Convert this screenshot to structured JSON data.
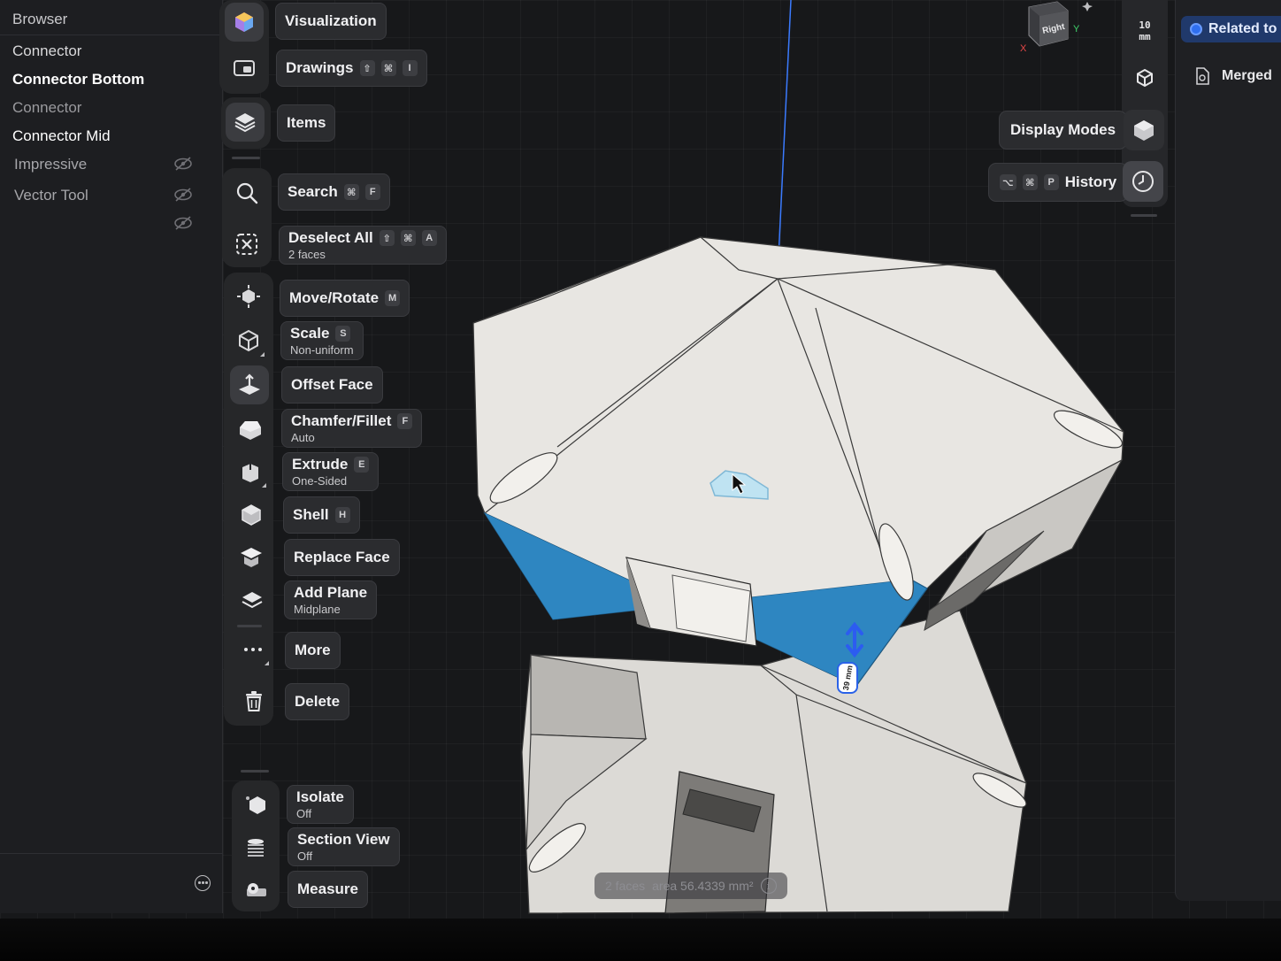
{
  "browser": {
    "title": "Browser",
    "items": [
      {
        "label": "Connector",
        "color": "#d8d8da"
      },
      {
        "label": "Connector Bottom",
        "color": "#ffffff",
        "weight": "bold"
      },
      {
        "label": "Connector",
        "color": "#9a9a9e"
      },
      {
        "label": "Connector Mid",
        "color": "#ffffff"
      },
      {
        "label": "Impressive",
        "color": "#a6a6aa",
        "hidden": true
      },
      {
        "label": "Vector Tool",
        "color": "#a6a6aa",
        "hidden": true
      },
      {
        "label": "",
        "hidden": true
      }
    ]
  },
  "toolbar": {
    "visualization": {
      "label": "Visualization",
      "icon": "cube-gradient-icon"
    },
    "drawings": {
      "label": "Drawings",
      "keys": [
        "⇧",
        "⌘",
        "I"
      ],
      "icon": "drawings-icon"
    },
    "items": {
      "label": "Items",
      "icon": "layers-icon"
    },
    "search": {
      "label": "Search",
      "keys": [
        "⌘",
        "F"
      ],
      "icon": "search-icon"
    },
    "deselect": {
      "label": "Deselect All",
      "sub": "2 faces",
      "keys": [
        "⇧",
        "⌘",
        "A"
      ],
      "icon": "deselect-icon"
    },
    "move_rotate": {
      "label": "Move/Rotate",
      "keys": [
        "M"
      ],
      "icon": "move-rotate-icon"
    },
    "scale": {
      "label": "Scale",
      "sub": "Non-uniform",
      "keys": [
        "S"
      ],
      "icon": "scale-icon"
    },
    "offset_face": {
      "label": "Offset Face",
      "icon": "offset-face-icon"
    },
    "chamfer": {
      "label": "Chamfer/Fillet",
      "sub": "Auto",
      "keys": [
        "F"
      ],
      "icon": "chamfer-icon"
    },
    "extrude": {
      "label": "Extrude",
      "sub": "One-Sided",
      "keys": [
        "E"
      ],
      "icon": "extrude-icon"
    },
    "shell": {
      "label": "Shell",
      "keys": [
        "H"
      ],
      "icon": "shell-icon"
    },
    "replace_face": {
      "label": "Replace Face",
      "icon": "replace-face-icon"
    },
    "add_plane": {
      "label": "Add Plane",
      "sub": "Midplane",
      "icon": "add-plane-icon"
    },
    "more": {
      "label": "More",
      "icon": "more-icon"
    },
    "delete": {
      "label": "Delete",
      "icon": "trash-icon"
    },
    "isolate": {
      "label": "Isolate",
      "sub": "Off",
      "icon": "isolate-icon"
    },
    "section_view": {
      "label": "Section View",
      "sub": "Off",
      "icon": "section-view-icon"
    },
    "measure": {
      "label": "Measure",
      "icon": "measure-icon"
    }
  },
  "view": {
    "units_value": "10",
    "units_unit": "mm",
    "cube_face": "Right",
    "axis_y": "Y",
    "axis_x": "X",
    "display_modes": "Display Modes",
    "history": {
      "label": "History",
      "keys": [
        "⌥",
        "⌘",
        "P"
      ]
    }
  },
  "related": {
    "tab": "Related to",
    "item": "Merged"
  },
  "status": {
    "faces": "2 faces",
    "area": "area 56.4339 mm²",
    "info": "i"
  },
  "dimension_badge": "39 mm",
  "colors": {
    "selection": "#2e86c1",
    "accent": "#2f6ff0",
    "axis": "#3b7bff"
  }
}
